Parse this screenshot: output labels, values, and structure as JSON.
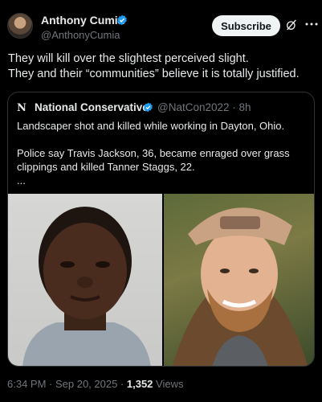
{
  "author": {
    "name": "Anthony Cumia",
    "handle": "@AnthonyCumia",
    "subscribe_label": "Subscribe"
  },
  "tweet": {
    "text": "They will kill over the slightest perceived slight.\nThey and their “communities” believe it is totally justified."
  },
  "quoted": {
    "logo": "N",
    "name": "National Conservative",
    "handle_time": "@NatCon2022 · 8h",
    "text": "Landscaper shot and killed while working in Dayton, Ohio.\n\nPolice say Travis Jackson, 36, became enraged over grass clippings and killed Tanner Staggs, 22.\n..."
  },
  "meta": {
    "time_date": "6:34 PM · Sep 20, 2025 · ",
    "views_count": "1,352",
    "views_label": " Views"
  },
  "icons": [
    "verified-badge-icon",
    "grok-icon",
    "more-icon",
    "national-conservative-logo-icon"
  ],
  "colors": {
    "background": "#000000",
    "text": "#e7e9ea",
    "secondary": "#71767b",
    "verified": "#1d9bf0"
  }
}
